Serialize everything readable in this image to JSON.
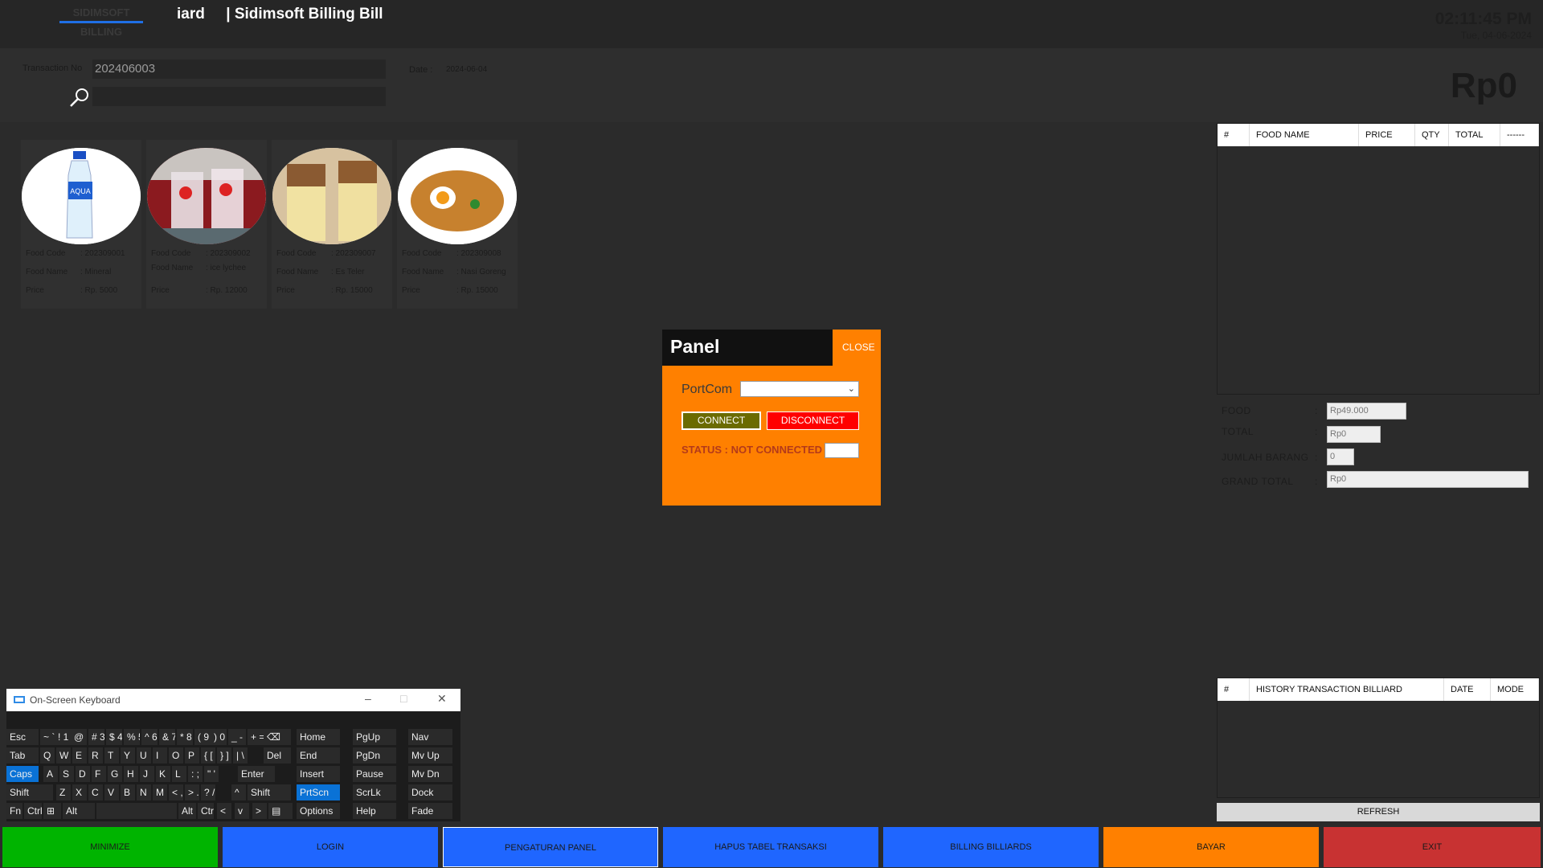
{
  "header": {
    "brand_top": "SIDIMSOFT",
    "brand_bottom": "BILLING",
    "title": "iard     | Sidimsoft Billing Bill",
    "time": "02:11:45 PM",
    "date": "Tue, 04-06-2024"
  },
  "transaction": {
    "label": "Transaction No",
    "number": "202406003",
    "date_label": "Date :",
    "date_value": "2024-06-04",
    "big_total": "Rp0",
    "search_icon": "search-icon"
  },
  "foods": [
    {
      "code_label": "Food Code",
      "code": ": 202309001",
      "name_label": "Food Name",
      "name": ": Mineral",
      "price_label": "Price",
      "price": ": Rp. 5000",
      "image": "water-bottle"
    },
    {
      "code_label": "Food Code",
      "code": ": 202309002",
      "name_label": "Food Name",
      "name": ": ice lychee",
      "price_label": "Price",
      "price": ": Rp. 12000",
      "image": "ice-lychee"
    },
    {
      "code_label": "Food Code",
      "code": ": 202309007",
      "name_label": "Food Name",
      "name": ": Es Teler",
      "price_label": "Price",
      "price": ": Rp. 15000",
      "image": "es-teler"
    },
    {
      "code_label": "Food Code",
      "code": ": 202309008",
      "name_label": "Food Name",
      "name": ": Nasi Goreng",
      "price_label": "Price",
      "price": ": Rp. 15000",
      "image": "nasi-goreng"
    }
  ],
  "order_table": {
    "columns": [
      "#",
      "FOOD NAME",
      "PRICE",
      "QTY",
      "TOTAL",
      "------"
    ]
  },
  "summary": {
    "food_label": "FOOD",
    "food_value": "Rp49.000",
    "total_label": "TOTAL",
    "total_value": "Rp0",
    "jumlah_label": "JUMLAH BARANG",
    "jumlah_value": "0",
    "grand_label": "GRAND TOTAL",
    "grand_value": "Rp0",
    "colon": ":"
  },
  "history_table": {
    "columns": [
      "#",
      "HISTORY TRANSACTION BILLIARD",
      "DATE",
      "MODE"
    ]
  },
  "refresh_label": "REFRESH",
  "panel": {
    "title": "Panel",
    "close": "CLOSE",
    "port_label": "PortCom",
    "port_value": "",
    "connect": "CONNECT",
    "disconnect": "DISCONNECT",
    "status": "STATUS : NOT CONNECTED"
  },
  "buttons": [
    {
      "label": "MINIMIZE",
      "color": "#00b400"
    },
    {
      "label": "LOGIN",
      "color": "#1f66ff"
    },
    {
      "label": "PENGATURAN PANEL",
      "color": "#1f66ff"
    },
    {
      "label": "HAPUS TABEL TRANSAKSI",
      "color": "#1f66ff"
    },
    {
      "label": "BILLING BILLIARDS",
      "color": "#1f66ff"
    },
    {
      "label": "BAYAR",
      "color": "#ff8000"
    },
    {
      "label": "EXIT",
      "color": "#c83232"
    }
  ],
  "keyboard": {
    "title": "On-Screen Keyboard",
    "rows": [
      [
        "Esc",
        "~ `",
        "! 1",
        "@ 2",
        "# 3",
        "$ 4",
        "% 5",
        "^ 6",
        "& 7",
        "* 8",
        "( 9",
        ") 0",
        "_ -",
        "+ =",
        "⌫",
        "Home",
        "PgUp",
        "Nav"
      ],
      [
        "Tab",
        "Q",
        "W",
        "E",
        "R",
        "T",
        "Y",
        "U",
        "I",
        "O",
        "P",
        "{ [",
        "} ]",
        "| \\",
        "Del",
        "End",
        "PgDn",
        "Mv Up"
      ],
      [
        "Caps",
        "A",
        "S",
        "D",
        "F",
        "G",
        "H",
        "J",
        "K",
        "L",
        ": ;",
        "\" '",
        "Enter",
        "Insert",
        "Pause",
        "Mv Dn"
      ],
      [
        "Shift",
        "Z",
        "X",
        "C",
        "V",
        "B",
        "N",
        "M",
        "< ,",
        "> .",
        "? /",
        "^",
        "Shift",
        "PrtScn",
        "ScrLk",
        "Dock"
      ],
      [
        "Fn",
        "Ctrl",
        "⊞",
        "Alt",
        "",
        "Alt",
        "Ctrl",
        "<",
        "v",
        ">",
        "▤",
        "Options",
        "Help",
        "Fade"
      ]
    ]
  }
}
